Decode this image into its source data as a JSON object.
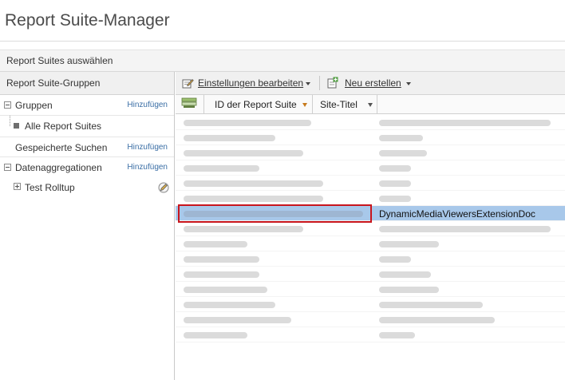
{
  "app": {
    "title": "Report Suite-Manager"
  },
  "subheader": {
    "label": "Report Suites auswählen"
  },
  "sidebar": {
    "header": "Report Suite-Gruppen",
    "items": [
      {
        "label": "Gruppen",
        "action": "Hinzufügen"
      },
      {
        "label": "Alle Report Suites"
      },
      {
        "label": "Gespeicherte Suchen",
        "action": "Hinzufügen"
      },
      {
        "label": "Datenaggregationen",
        "action": "Hinzufügen"
      },
      {
        "label": "Test Rolltup"
      }
    ]
  },
  "toolbar": {
    "edit_settings": "Einstellungen bearbeiten",
    "create_new": "Neu erstellen"
  },
  "table": {
    "columns": [
      "ID der Report Suite",
      "Site-Titel"
    ],
    "selected_row_title": "DynamicMediaViewersExtensionDoc",
    "selected_row_index": 6,
    "row_count": 15
  },
  "colors": {
    "selection": "#a8c8ea",
    "highlight_border": "#c8151d",
    "link": "#3a6ea5",
    "sort_indicator": "#c77a1c"
  }
}
